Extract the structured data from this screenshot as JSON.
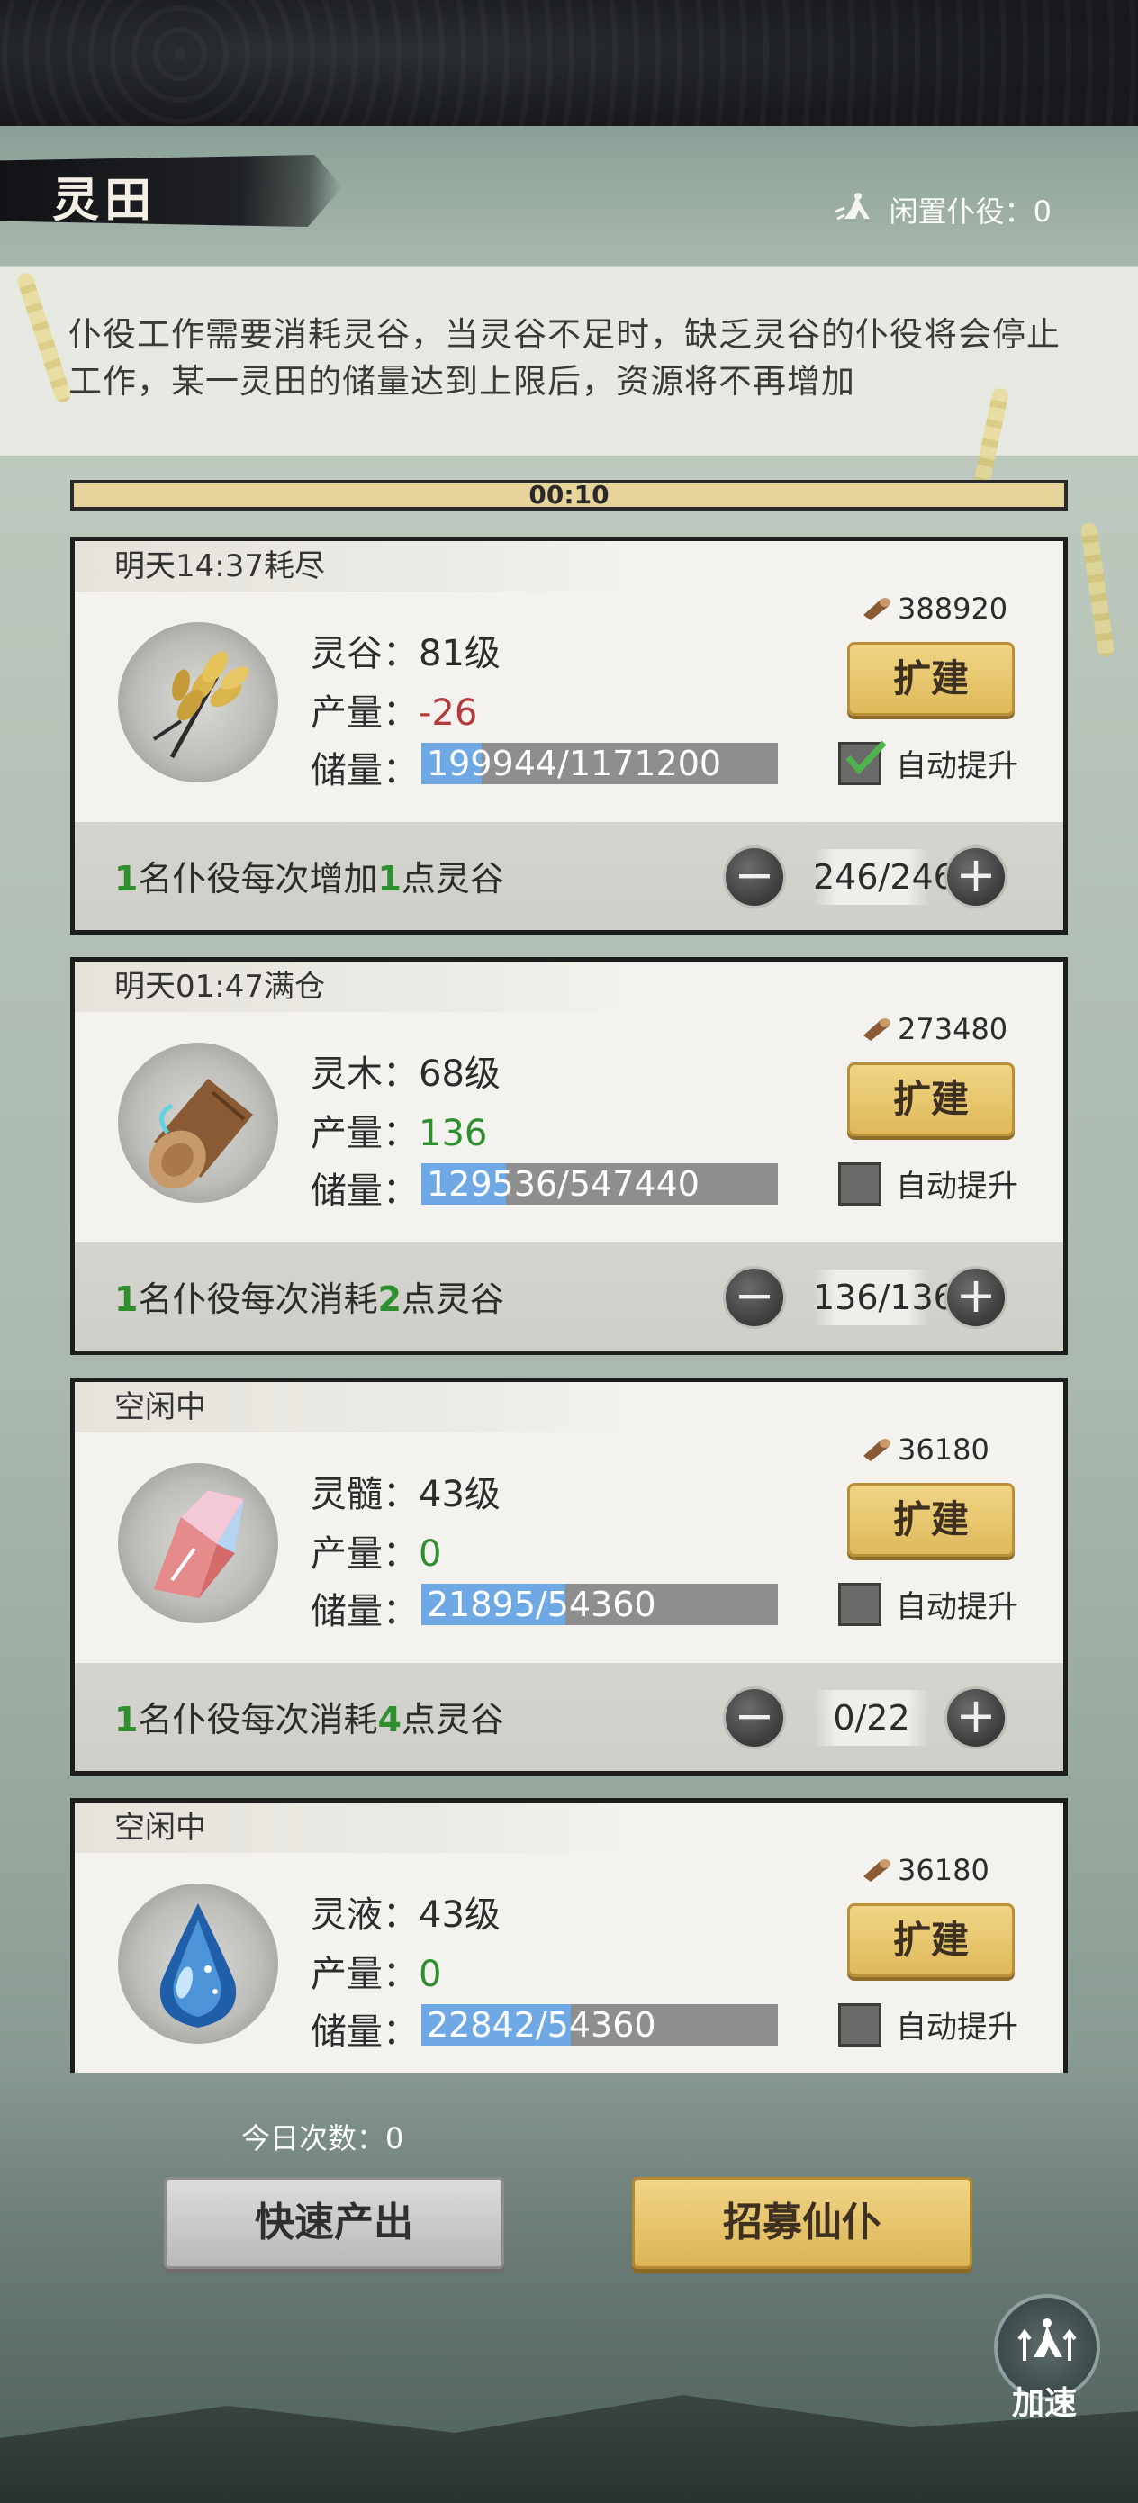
{
  "header": {
    "title": "灵田",
    "idle_workers_label": "闲置仆役：0"
  },
  "description": "仆役工作需要消耗灵谷，当灵谷不足时，缺乏灵谷的仆役将会停止工作，某一灵田的储量达到上限后，资源将不再增加",
  "timer": "00:10",
  "fields": [
    {
      "status": "明天14:37耗尽",
      "icon": "grain-icon",
      "name_label": "灵谷：",
      "level": "81级",
      "output_label": "产量：",
      "output": "-26",
      "output_color": "#b23a3a",
      "storage_label": "储量：",
      "storage_text": "199944/1171200",
      "storage_fraction": 0.17,
      "cost": "388920",
      "expand_label": "扩建",
      "auto_label": "自动提升",
      "auto_checked": true,
      "worker_prefix": "1",
      "worker_mid": "名仆役每次增加",
      "worker_amount": "1",
      "worker_suffix": "点灵谷",
      "worker_count": "246/246"
    },
    {
      "status": "明天01:47满仓",
      "icon": "wood-icon",
      "name_label": "灵木：",
      "level": "68级",
      "output_label": "产量：",
      "output": "136",
      "output_color": "#2f8f2f",
      "storage_label": "储量：",
      "storage_text": "129536/547440",
      "storage_fraction": 0.237,
      "cost": "273480",
      "expand_label": "扩建",
      "auto_label": "自动提升",
      "auto_checked": false,
      "worker_prefix": "1",
      "worker_mid": "名仆役每次消耗",
      "worker_amount": "2",
      "worker_suffix": "点灵谷",
      "worker_count": "136/136"
    },
    {
      "status": "空闲中",
      "icon": "crystal-icon",
      "name_label": "灵髓：",
      "level": "43级",
      "output_label": "产量：",
      "output": "0",
      "output_color": "#2f8f2f",
      "storage_label": "储量：",
      "storage_text": "21895/54360",
      "storage_fraction": 0.403,
      "cost": "36180",
      "expand_label": "扩建",
      "auto_label": "自动提升",
      "auto_checked": false,
      "worker_prefix": "1",
      "worker_mid": "名仆役每次消耗",
      "worker_amount": "4",
      "worker_suffix": "点灵谷",
      "worker_count": "0/22"
    },
    {
      "status": "空闲中",
      "icon": "water-drop-icon",
      "name_label": "灵液：",
      "level": "43级",
      "output_label": "产量：",
      "output": "0",
      "output_color": "#2f8f2f",
      "storage_label": "储量：",
      "storage_text": "22842/54360",
      "storage_fraction": 0.42,
      "cost": "36180",
      "expand_label": "扩建",
      "auto_label": "自动提升",
      "auto_checked": false
    }
  ],
  "footer": {
    "today_count": "今日次数：0",
    "quick_produce": "快速产出",
    "recruit": "招募仙仆",
    "speed_up": "加速"
  },
  "colors": {
    "accent_gold": "#e7c66e",
    "progress_blue": "#6ea9e6",
    "positive_green": "#2f8f2f",
    "negative_red": "#b23a3a"
  }
}
